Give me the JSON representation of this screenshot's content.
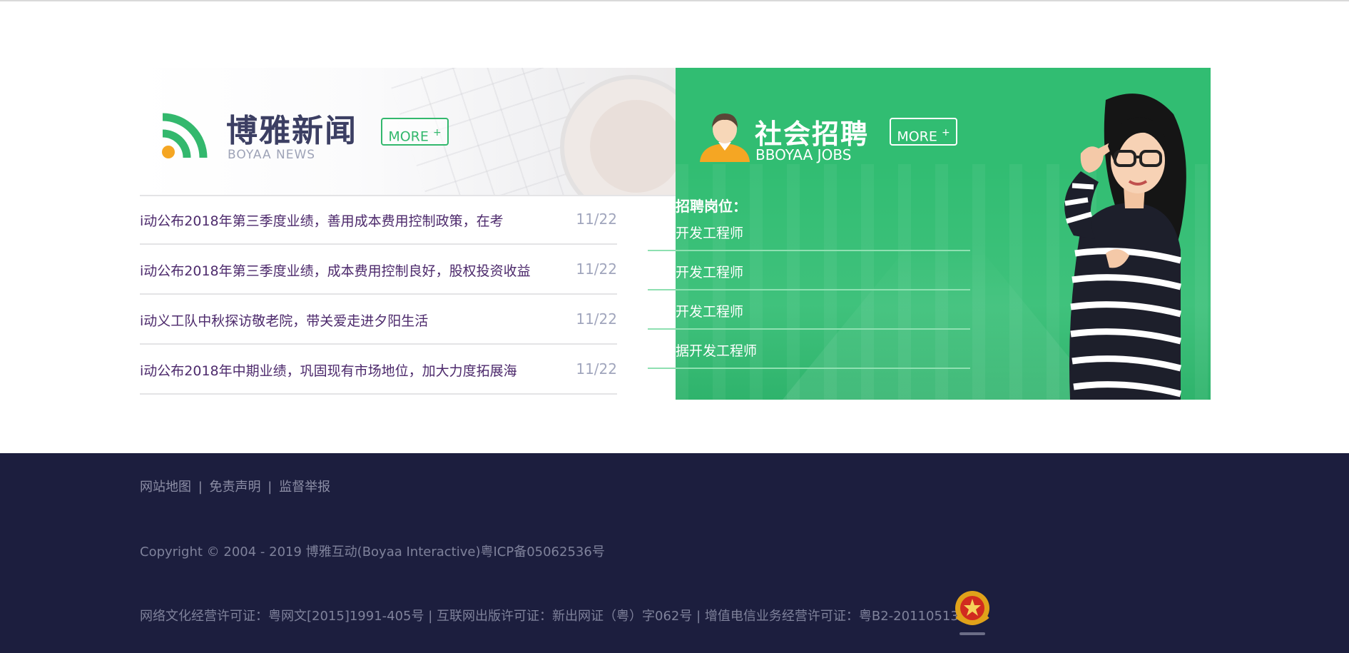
{
  "news": {
    "title": "博雅新闻",
    "subtitle": "BOYAA NEWS",
    "more_label": "MORE",
    "more_plus": "+",
    "items": [
      {
        "text": "i动公布2018年第三季度业绩，善用成本费用控制政策，在考",
        "date": "11/22"
      },
      {
        "text": "i动公布2018年第三季度业绩，成本费用控制良好，股权投资收益",
        "date": "11/22"
      },
      {
        "text": "i动义工队中秋探访敬老院，带关爱走进夕阳生活",
        "date": "11/22"
      },
      {
        "text": "i动公布2018年中期业绩，巩固现有市场地位，加大力度拓展海",
        "date": "11/22"
      }
    ]
  },
  "jobs": {
    "title": "社会招聘",
    "subtitle": "BBOYAA JOBS",
    "more_label": "MORE",
    "more_plus": "+",
    "positions_label": "招聘岗位：",
    "items": [
      {
        "title": "开发工程师"
      },
      {
        "title": "开发工程师"
      },
      {
        "title": "开发工程师"
      },
      {
        "title": "据开发工程师"
      }
    ]
  },
  "footer": {
    "links": [
      "网站地图",
      "免责声明",
      "监督举报"
    ],
    "separator": "|",
    "copyright": "Copyright © 2004 - 2019 博雅互动(Boyaa Interactive)粤ICP备05062536号",
    "licenses": "网络文化经营许可证：粤网文[2015]1991-405号 | 互联网出版许可证：新出网证（粤）字062号 | 增值电信业务经营许可证：粤B2-20110513"
  },
  "colors": {
    "accent_green": "#31bd72",
    "footer_bg": "#1c1e3e",
    "news_title": "#3c3f63",
    "news_text": "#4d2a6c",
    "date_text": "#a1a6bd",
    "rss_orange": "#f5a623"
  },
  "icons": {
    "news": "rss-icon",
    "jobs": "person-avatar-icon",
    "badge": "government-emblem-icon"
  }
}
